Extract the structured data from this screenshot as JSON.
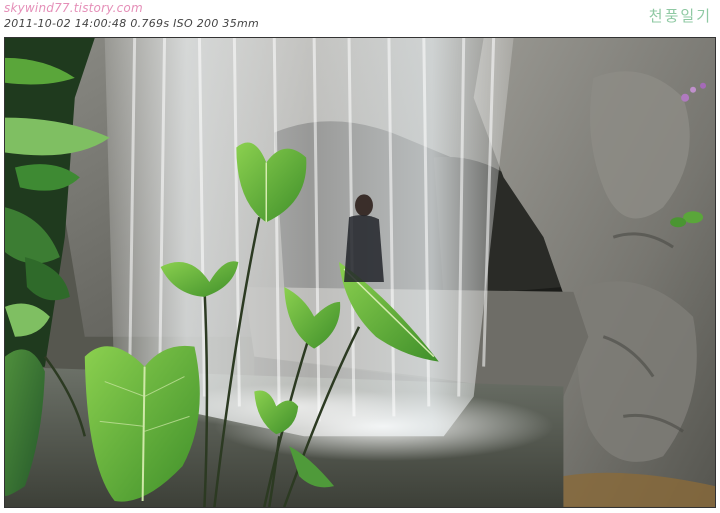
{
  "header": {
    "site": "skywind77.tistory.com",
    "exif": "2011-10-02  14:00:48  0.769s  ISO 200  35mm",
    "signature": "천풍일기"
  },
  "photo": {
    "subject": "waterfall-scene",
    "colors": {
      "rock": "#6f6f6a",
      "foliage": "#5aa63a",
      "water": "#e6ecef",
      "cave": "#1e1f1c",
      "pool": "#4a4e46"
    }
  }
}
